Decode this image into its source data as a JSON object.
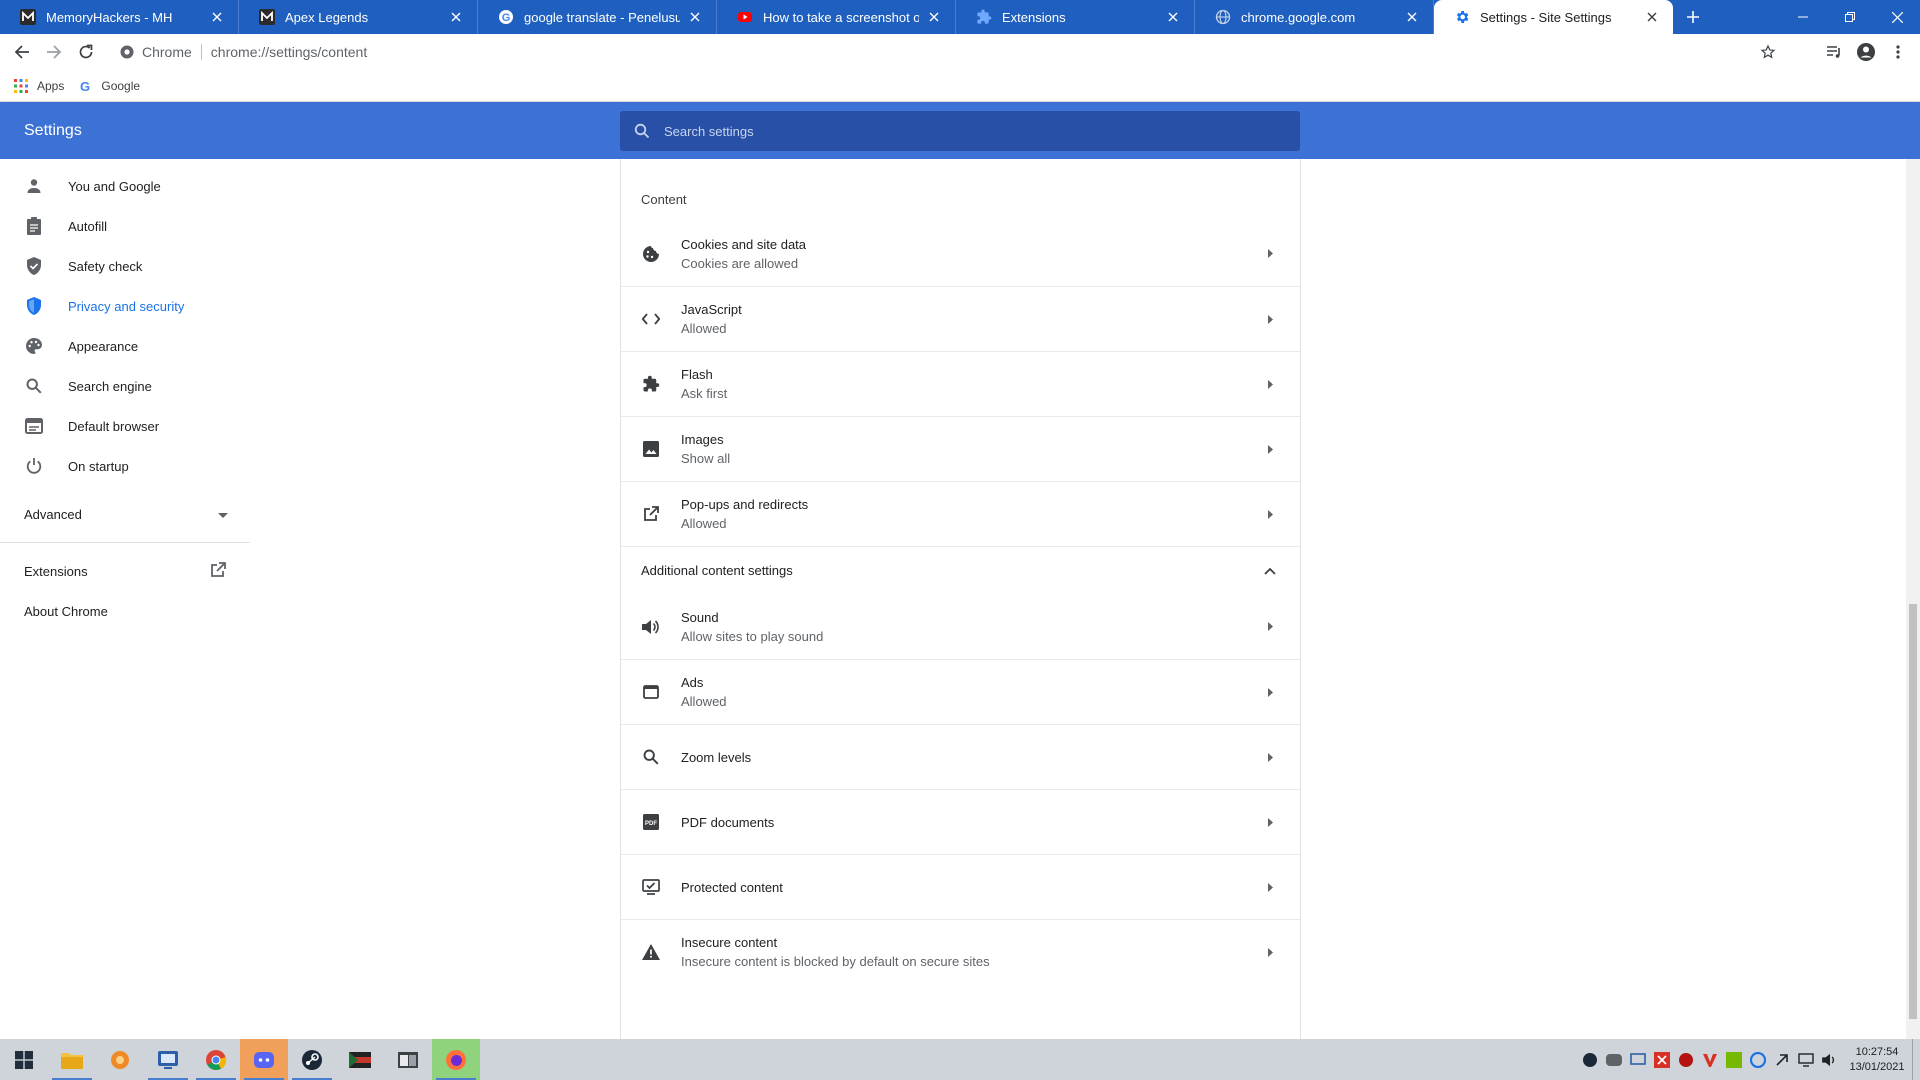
{
  "tabs": [
    {
      "title": "MemoryHackers - MH",
      "favicon": "m-logo-icon"
    },
    {
      "title": "Apex Legends",
      "favicon": "m-logo-icon"
    },
    {
      "title": "google translate - Penelusuran G",
      "favicon": "google-icon"
    },
    {
      "title": "How to take a screenshot on a P",
      "favicon": "youtube-icon"
    },
    {
      "title": "Extensions",
      "favicon": "puzzle-icon"
    },
    {
      "title": "chrome.google.com",
      "favicon": "globe-icon"
    },
    {
      "title": "Settings - Site Settings",
      "favicon": "gear-icon"
    }
  ],
  "omnibox": {
    "chip": "Chrome",
    "url": "chrome://settings/content"
  },
  "bookmarks": [
    {
      "label": "Apps",
      "icon": "apps-grid-icon"
    },
    {
      "label": "Google",
      "icon": "google-icon"
    }
  ],
  "header": {
    "title": "Settings",
    "search_placeholder": "Search settings"
  },
  "sidebar": {
    "items": [
      {
        "label": "You and Google",
        "icon": "person-icon"
      },
      {
        "label": "Autofill",
        "icon": "clipboard-icon"
      },
      {
        "label": "Safety check",
        "icon": "shield-check-icon"
      },
      {
        "label": "Privacy and security",
        "icon": "shield-icon"
      },
      {
        "label": "Appearance",
        "icon": "palette-icon"
      },
      {
        "label": "Search engine",
        "icon": "search-icon"
      },
      {
        "label": "Default browser",
        "icon": "browser-icon"
      },
      {
        "label": "On startup",
        "icon": "power-icon"
      }
    ],
    "advanced": "Advanced",
    "extensions": "Extensions",
    "about": "About Chrome"
  },
  "content": {
    "heading": "Content",
    "items": [
      {
        "label": "Cookies and site data",
        "sub": "Cookies are allowed",
        "icon": "cookie-icon"
      },
      {
        "label": "JavaScript",
        "sub": "Allowed",
        "icon": "code-icon"
      },
      {
        "label": "Flash",
        "sub": "Ask first",
        "icon": "puzzle-icon"
      },
      {
        "label": "Images",
        "sub": "Show all",
        "icon": "image-icon"
      },
      {
        "label": "Pop-ups and redirects",
        "sub": "Allowed",
        "icon": "open-in-new-icon"
      }
    ],
    "additional_heading": "Additional content settings",
    "additional": [
      {
        "label": "Sound",
        "sub": "Allow sites to play sound",
        "icon": "volume-icon"
      },
      {
        "label": "Ads",
        "sub": "Allowed",
        "icon": "ads-icon"
      },
      {
        "label": "Zoom levels",
        "sub": "",
        "icon": "zoom-icon"
      },
      {
        "label": "PDF documents",
        "sub": "",
        "icon": "pdf-icon"
      },
      {
        "label": "Protected content",
        "sub": "",
        "icon": "protected-icon"
      },
      {
        "label": "Insecure content",
        "sub": "Insecure content is blocked by default on secure sites",
        "icon": "warning-icon"
      }
    ]
  },
  "taskbar": {
    "time": "10:27:54",
    "date": "13/01/2021"
  },
  "colors": {
    "tabstrip": "#1f5fbf",
    "header": "#3c72d6",
    "search": "#2850a6",
    "accent": "#1a73e8"
  }
}
